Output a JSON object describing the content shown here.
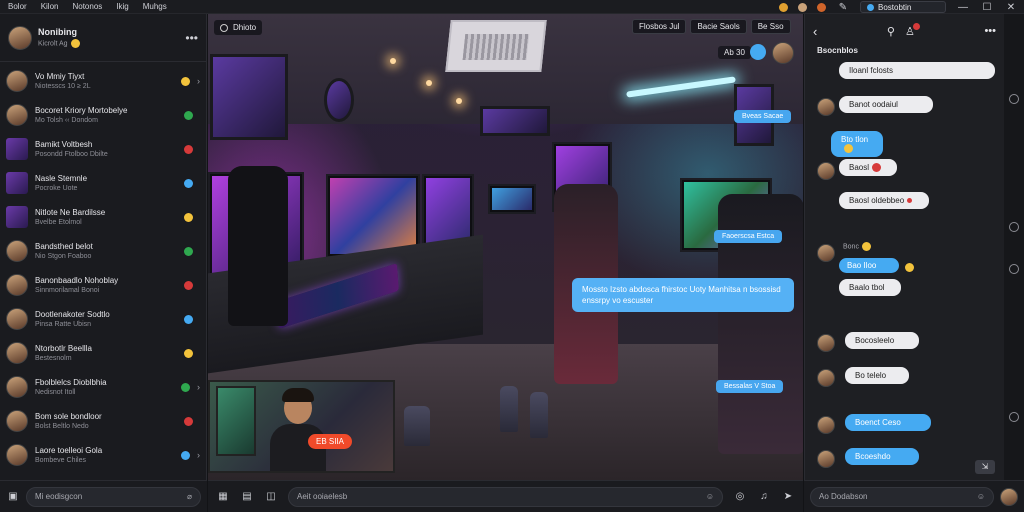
{
  "menu": [
    "Bolor",
    "Kilon",
    "Notonos",
    "Ikig",
    "Muhgs"
  ],
  "topbar": {
    "ext_tab": "Bostobtin"
  },
  "sidebar": {
    "user_name": "Nonibing",
    "user_sub": "Kicrolt Ag",
    "items": [
      {
        "t1": "Vo Mmiy Tiyxt",
        "t2": "Niotesscs 10 ≥ 2L",
        "thumb": "av"
      },
      {
        "t1": "Bocoret Kriory Mortobelye",
        "t2": "Mo Tolsh ‹‹ Dondom",
        "thumb": "av"
      },
      {
        "t1": "Bamikt Voltbesh",
        "t2": "Posondd Ftolboo Dbilte",
        "thumb": "sq"
      },
      {
        "t1": "Nasle Stemnle",
        "t2": "Pocroke Uote",
        "thumb": "sq"
      },
      {
        "t1": "Nitlote Ne Bardilsse",
        "t2": "Bvelbe Etolmol",
        "thumb": "sq"
      },
      {
        "t1": "Bandsthed belot",
        "t2": "Nio Stgon Foaboo",
        "thumb": "av"
      },
      {
        "t1": "Banonbaadlo Nohoblay",
        "t2": "Sinnmorilamal Bonoi",
        "thumb": "av"
      },
      {
        "t1": "Dootlenakoter Sodtlo",
        "t2": "Pinsa Ratte Ubisn",
        "thumb": "av"
      },
      {
        "t1": "Ntorbotlr Beellla",
        "t2": "Bestesnolm",
        "thumb": "av"
      },
      {
        "t1": "Fbolblelcs Dioblbhia",
        "t2": "Nedisnot Itoll",
        "thumb": "av"
      },
      {
        "t1": "Bom sole bondloor",
        "t2": "Bolst Beltlo Nedo",
        "thumb": "av"
      },
      {
        "t1": "Laore toelleoi Gola",
        "t2": "Bombeve Chiles",
        "thumb": "av"
      }
    ],
    "input_placeholder": "Mi eodisgcon"
  },
  "stage": {
    "label": "Dhioto",
    "tabs": [
      "Flosbos Jul",
      "Bacie Saols",
      "Be Sso"
    ],
    "live_count": "Ab 30",
    "chip_blue_1": "Bveas Sacae",
    "chip_blue_2": "Faoerscsa Estca",
    "chip_blue_3": "Bessalas V Stoa",
    "big_bubble": "Mossto Izsto abdosca fhirstoc Uoty Manhitsa n bsossisd enssrpy vo escuster",
    "pip_live": "EB SIIA",
    "input_text": "Aeit ooiaelesb"
  },
  "rpanel": {
    "title": "Bsocnblos",
    "messages": [
      {
        "text": "Iloanl fclosts",
        "dir": "in"
      },
      {
        "text": "Banot oodaiul",
        "dir": "in"
      },
      {
        "text": "Bto tlon",
        "dir": "out"
      },
      {
        "text": "Baosl",
        "dir": "in"
      },
      {
        "text": "Baosl oldebbeo",
        "dir": "in"
      },
      {
        "text": "Bonc",
        "dir": "sender"
      },
      {
        "text": "Bao Iloo",
        "dir": "out"
      },
      {
        "text": "Baalo tbol",
        "dir": "in"
      },
      {
        "text": "Bocosleelo",
        "dir": "in"
      },
      {
        "text": "Bo telelo",
        "dir": "in"
      },
      {
        "text": "Boenct Ceso",
        "dir": "out"
      },
      {
        "text": "Bcoeshdo",
        "dir": "out"
      }
    ],
    "input_placeholder": "Ao Dodabson"
  },
  "colors": {
    "accent_blue": "#45aaf2",
    "live_red": "#f04a2a",
    "badge_green": "#2fa84f"
  }
}
